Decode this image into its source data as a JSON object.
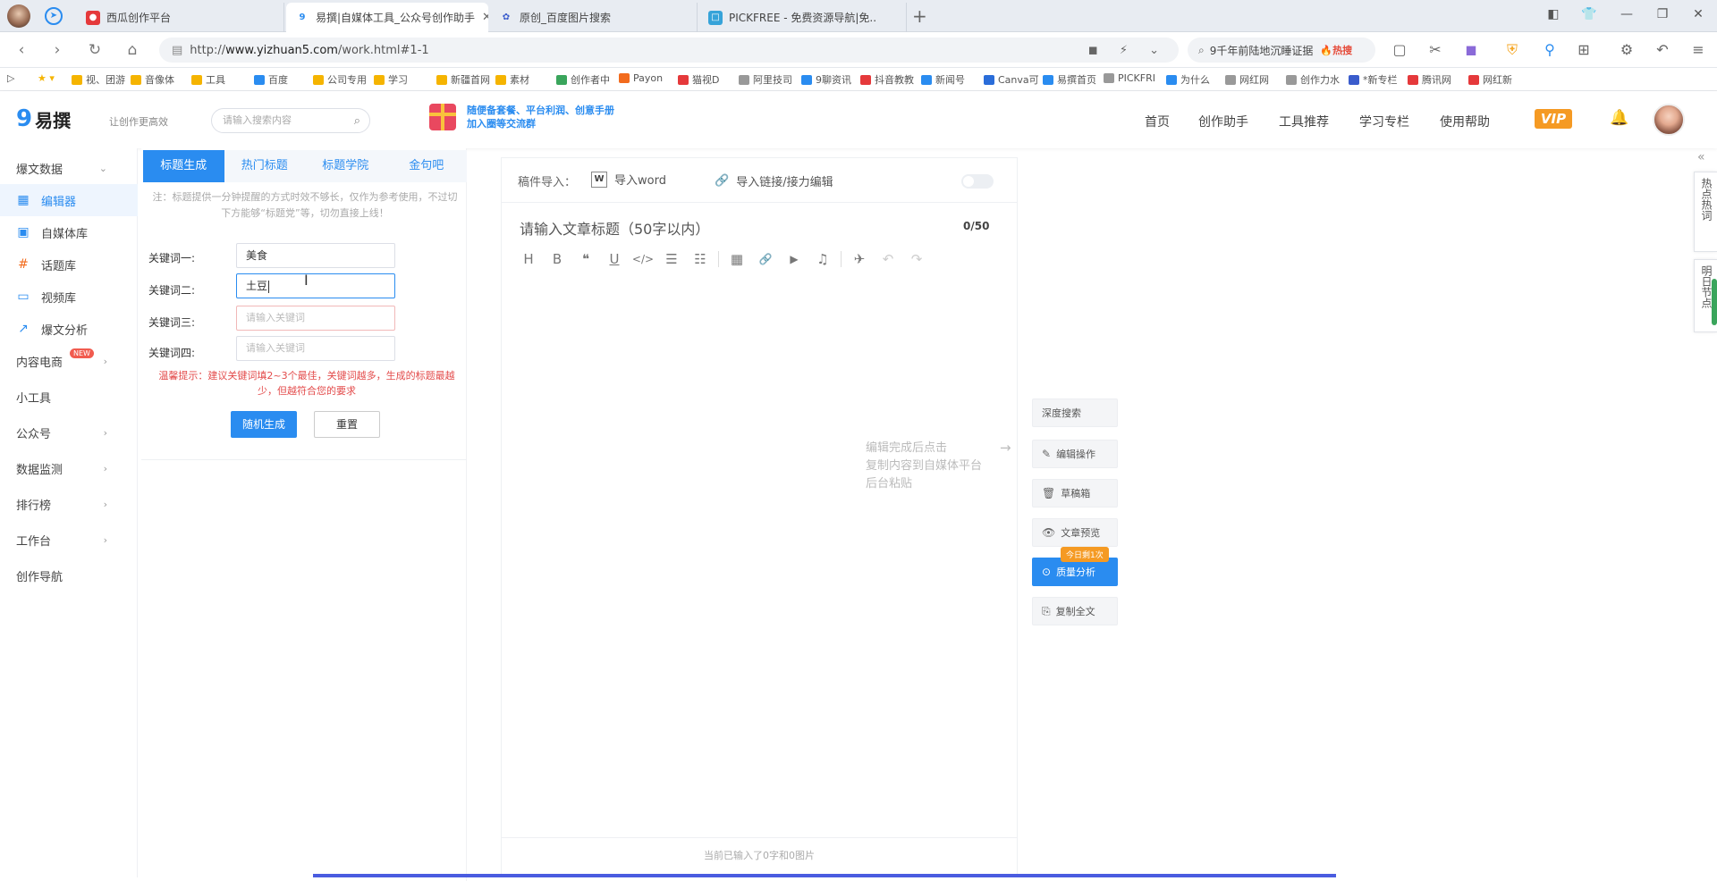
{
  "browser": {
    "tabs": [
      {
        "label": "西瓜创作平台",
        "color": "#e5393b"
      },
      {
        "label": "易撰|自媒体工具_公众号创作助手",
        "color": "#2a8cf0"
      },
      {
        "label": "原创_百度图片搜索",
        "color": "#3a5ccc"
      },
      {
        "label": "PICKFREE - 免费资源导航|免..",
        "color": "#36a3d9"
      }
    ],
    "new_tab": "+",
    "url_prefix": "http://",
    "url_host": "www.yizhuan5.com",
    "url_path": "/work.html#1-1",
    "search_text": "9千年前陆地沉睡证据",
    "search_hot": "🔥热搜",
    "bookmarks": [
      "视、团游",
      "音像体",
      "工具",
      "百度",
      "公司专用",
      "学习",
      "新疆首网",
      "素材",
      "创作者中",
      "Payon",
      "猫视D",
      "阿里技司",
      "9聊资讯",
      "抖音教教",
      "新闻号",
      "Canva可",
      "易撰首页",
      "PICKFRI",
      "为什么",
      "网红网",
      "创作力水",
      "*新专栏",
      "腾讯网",
      "网红新"
    ]
  },
  "site": {
    "slogan": "让创作更高效",
    "search_placeholder": "请输入搜索内容",
    "banner_line1": "随便备套餐、平台利润、创意手册",
    "banner_line2": "加入圈等交流群",
    "nav": [
      "首页",
      "创作助手",
      "工具推荐",
      "学习专栏",
      "使用帮助"
    ],
    "vip": "VIP"
  },
  "leftnav": {
    "items": [
      {
        "label": "爆文数据",
        "icon": "",
        "arrow": "⌄"
      },
      {
        "label": "编辑器",
        "icon": "editor-icon",
        "active": true
      },
      {
        "label": "自媒体库",
        "icon": "library-icon"
      },
      {
        "label": "话题库",
        "icon": "hashtag-icon"
      },
      {
        "label": "视频库",
        "icon": "video-icon"
      },
      {
        "label": "爆文分析",
        "icon": "chart-icon"
      },
      {
        "label": "内容电商",
        "arrow": "›",
        "badge": "NEW"
      },
      {
        "label": "小工具"
      },
      {
        "label": "公众号",
        "arrow": "›"
      },
      {
        "label": "数据监测",
        "arrow": "›"
      },
      {
        "label": "排行榜",
        "arrow": "›"
      },
      {
        "label": "工作台",
        "arrow": "›"
      },
      {
        "label": "创作导航"
      }
    ]
  },
  "toolpanel": {
    "tabs": [
      "标题生成",
      "热门标题",
      "标题学院",
      "金句吧"
    ],
    "tip": "注：标题提供一分钟提醒的方式时效不够长，仅作为参考使用，不过切下方能够“标题党”等，切勿直接上线！",
    "keywords": [
      {
        "label": "关键词一:",
        "value": "美食",
        "placeholder": ""
      },
      {
        "label": "关键词二:",
        "value": "土豆",
        "placeholder": ""
      },
      {
        "label": "关键词三:",
        "value": "",
        "placeholder": "请输入关键词"
      },
      {
        "label": "关键词四:",
        "value": "",
        "placeholder": "请输入关键词"
      }
    ],
    "hint": "温馨提示：建议关键词填2~3个最佳，关键词越多，生成的标题最越少，但越符合您的要求",
    "generate": "随机生成",
    "reset": "重置"
  },
  "editor": {
    "import_label": "稿件导入：",
    "import_word": "导入word",
    "import_link": "导入链接/接力编辑",
    "title_placeholder": "请输入文章标题（50字以内）",
    "title_count": "0/50",
    "toolbar": [
      "H",
      "B",
      "❝",
      "U",
      "</>",
      "☰",
      "☷",
      "▦",
      "🔗",
      "▶",
      "♫",
      "✈",
      "↶",
      "↷"
    ],
    "footer": "当前已输入了0字和0图片",
    "paste_hint": [
      "编辑完成后点击",
      "复制内容到自媒体平台",
      "后台粘贴"
    ]
  },
  "side_actions": [
    {
      "label": "深度搜索",
      "icon": ""
    },
    {
      "label": "编辑操作",
      "icon": "✎"
    },
    {
      "label": "草稿箱",
      "icon": "🗑"
    },
    {
      "label": "文章预览",
      "icon": "👁"
    },
    {
      "label": "质量分析",
      "icon": "⊙",
      "primary": true
    },
    {
      "label": "复制全文",
      "icon": "⎘"
    }
  ],
  "today_badge": "今日剩1次",
  "right_rail": {
    "tab1": "热点热词",
    "tab2": "明日节点",
    "collapse": "«"
  }
}
